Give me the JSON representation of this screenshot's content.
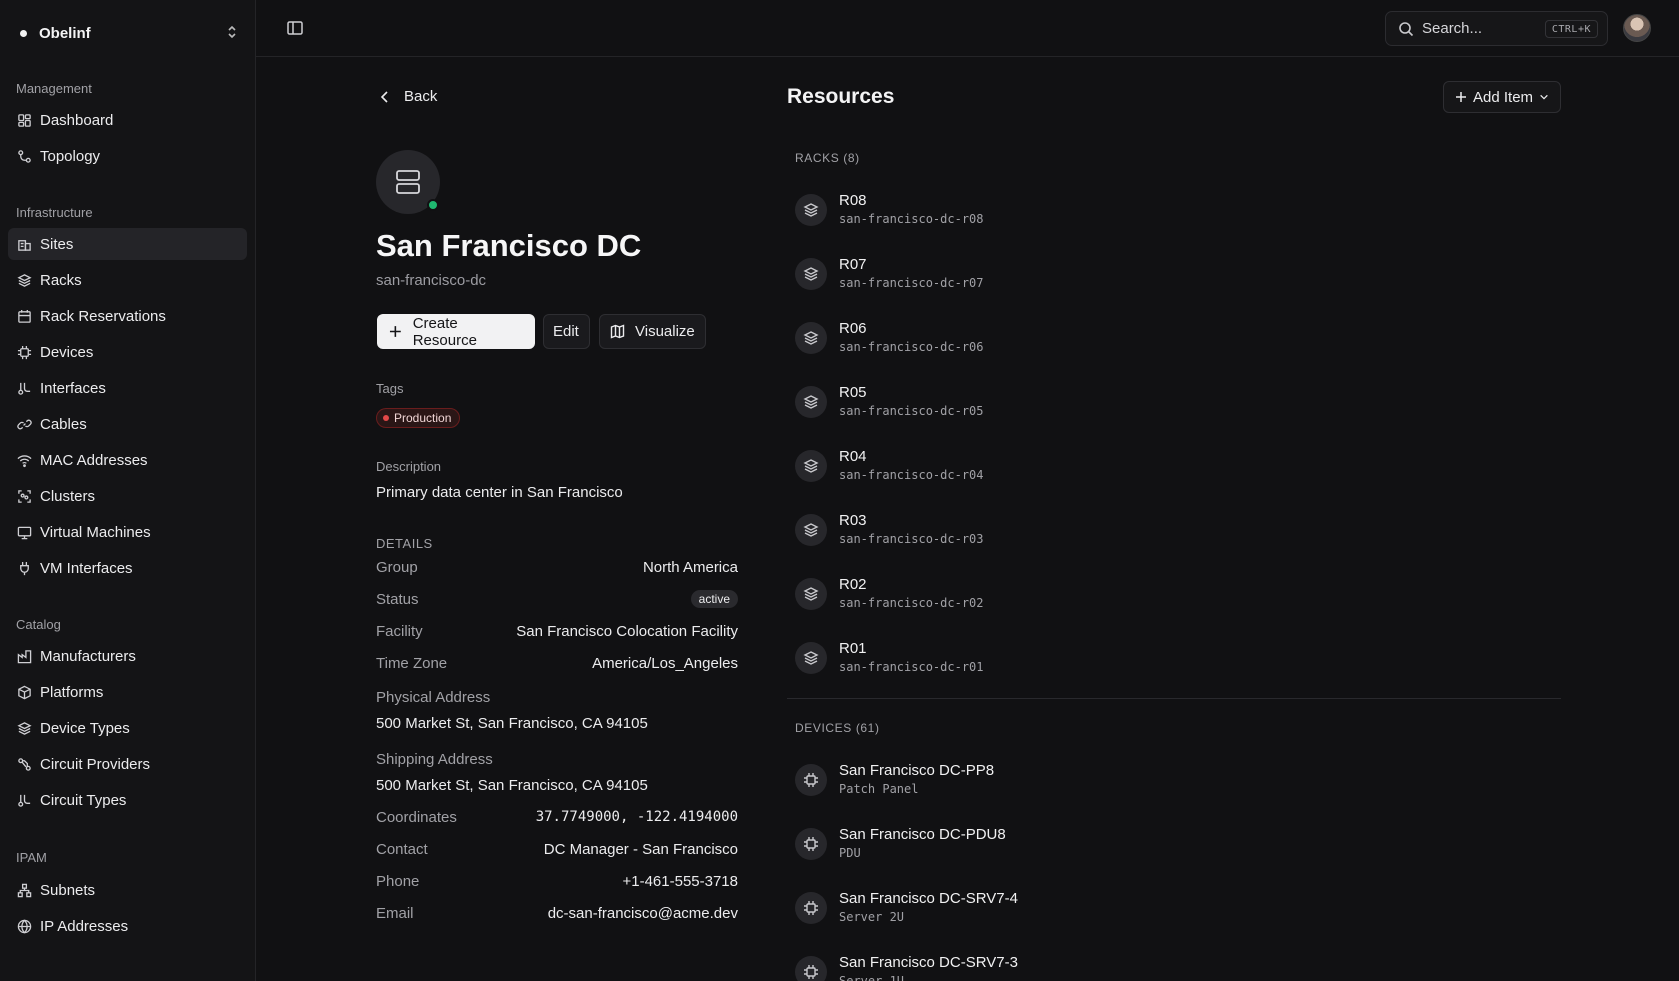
{
  "sidebar": {
    "org_name": "Obelinf",
    "sections": {
      "management": "Management",
      "infrastructure": "Infrastructure",
      "catalog": "Catalog",
      "ipam": "IPAM"
    },
    "items": [
      {
        "label": "Dashboard",
        "icon": "dashboard-icon"
      },
      {
        "label": "Topology",
        "icon": "topology-icon"
      },
      {
        "label": "Sites",
        "icon": "building-icon",
        "active": true
      },
      {
        "label": "Racks",
        "icon": "layers-icon"
      },
      {
        "label": "Rack Reservations",
        "icon": "calendar-icon"
      },
      {
        "label": "Devices",
        "icon": "chip-icon"
      },
      {
        "label": "Interfaces",
        "icon": "interfaces-icon"
      },
      {
        "label": "Cables",
        "icon": "link-icon"
      },
      {
        "label": "MAC Addresses",
        "icon": "wifi-icon"
      },
      {
        "label": "Clusters",
        "icon": "cluster-icon"
      },
      {
        "label": "Virtual Machines",
        "icon": "monitor-icon"
      },
      {
        "label": "VM Interfaces",
        "icon": "plug-icon"
      },
      {
        "label": "Manufacturers",
        "icon": "factory-icon"
      },
      {
        "label": "Platforms",
        "icon": "box-icon"
      },
      {
        "label": "Device Types",
        "icon": "layers-icon"
      },
      {
        "label": "Circuit Providers",
        "icon": "circuit-icon"
      },
      {
        "label": "Circuit Types",
        "icon": "interfaces-icon"
      },
      {
        "label": "Subnets",
        "icon": "network-icon"
      },
      {
        "label": "IP Addresses",
        "icon": "globe-icon"
      }
    ]
  },
  "topbar": {
    "search_placeholder": "Search...",
    "search_shortcut": "CTRL+K"
  },
  "site": {
    "back_label": "Back",
    "name": "San Francisco DC",
    "slug": "san-francisco-dc",
    "status_color": "#1fb870",
    "actions": {
      "create": "Create Resource",
      "edit": "Edit",
      "visualize": "Visualize"
    },
    "tags_label": "Tags",
    "tags": [
      "Production"
    ],
    "description_label": "Description",
    "description": "Primary data center in San Francisco",
    "details_label": "DETAILS",
    "details": {
      "group": {
        "k": "Group",
        "v": "North America"
      },
      "status": {
        "k": "Status",
        "v": "active"
      },
      "facility": {
        "k": "Facility",
        "v": "San Francisco Colocation Facility"
      },
      "timezone": {
        "k": "Time Zone",
        "v": "America/Los_Angeles"
      },
      "physical_address": {
        "k": "Physical Address",
        "v": "500 Market St, San Francisco, CA 94105"
      },
      "shipping_address": {
        "k": "Shipping Address",
        "v": "500 Market St, San Francisco, CA 94105"
      },
      "coordinates": {
        "k": "Coordinates",
        "v": "37.7749000, -122.4194000"
      },
      "contact": {
        "k": "Contact",
        "v": "DC Manager - San Francisco"
      },
      "phone": {
        "k": "Phone",
        "v": "+1-461-555-3718"
      },
      "email": {
        "k": "Email",
        "v": "dc-san-francisco@acme.dev"
      }
    }
  },
  "resources": {
    "title": "Resources",
    "add_label": "Add Item",
    "racks_header": "RACKS (8)",
    "racks": [
      {
        "name": "R08",
        "slug": "san-francisco-dc-r08"
      },
      {
        "name": "R07",
        "slug": "san-francisco-dc-r07"
      },
      {
        "name": "R06",
        "slug": "san-francisco-dc-r06"
      },
      {
        "name": "R05",
        "slug": "san-francisco-dc-r05"
      },
      {
        "name": "R04",
        "slug": "san-francisco-dc-r04"
      },
      {
        "name": "R03",
        "slug": "san-francisco-dc-r03"
      },
      {
        "name": "R02",
        "slug": "san-francisco-dc-r02"
      },
      {
        "name": "R01",
        "slug": "san-francisco-dc-r01"
      }
    ],
    "devices_header": "DEVICES (61)",
    "devices": [
      {
        "name": "San Francisco DC-PP8",
        "type": "Patch Panel"
      },
      {
        "name": "San Francisco DC-PDU8",
        "type": "PDU"
      },
      {
        "name": "San Francisco DC-SRV7-4",
        "type": "Server 2U"
      },
      {
        "name": "San Francisco DC-SRV7-3",
        "type": "Server 1U"
      }
    ]
  }
}
